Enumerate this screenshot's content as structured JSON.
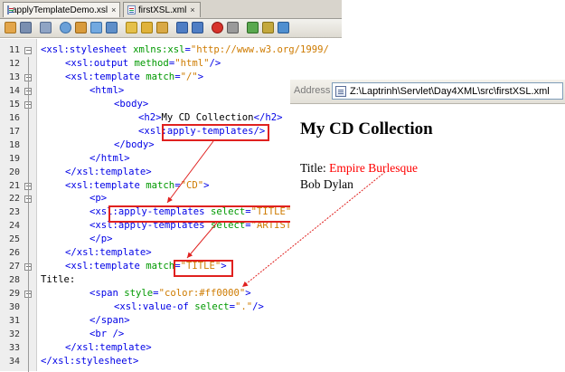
{
  "tabs": [
    {
      "label": "applyTemplateDemo.xsl",
      "close": "×"
    },
    {
      "label": "firstXSL.xml",
      "close": "×"
    }
  ],
  "colors": {
    "tag": "#0000e6",
    "attr": "#009900",
    "value": "#ce7b00",
    "text": "#000000",
    "highlight": "#e0211f",
    "output_title": "#ff0000"
  },
  "code_lines": [
    {
      "n": "11",
      "indent": 0,
      "parts": [
        [
          "t",
          "<xsl:stylesheet "
        ],
        [
          "a",
          "xmlns:xsl"
        ],
        [
          "t",
          "="
        ],
        [
          "v",
          "\"http://www.w3.org/1999/"
        ]
      ]
    },
    {
      "n": "12",
      "indent": 1,
      "parts": [
        [
          "t",
          "<xsl:output "
        ],
        [
          "a",
          "method"
        ],
        [
          "t",
          "="
        ],
        [
          "v",
          "\"html\""
        ],
        [
          "t",
          "/>"
        ]
      ]
    },
    {
      "n": "13",
      "indent": 1,
      "parts": [
        [
          "t",
          "<xsl:template "
        ],
        [
          "a",
          "match"
        ],
        [
          "t",
          "="
        ],
        [
          "v",
          "\"/\""
        ],
        [
          "t",
          ">"
        ]
      ]
    },
    {
      "n": "14",
      "indent": 2,
      "parts": [
        [
          "t",
          "<html>"
        ]
      ]
    },
    {
      "n": "15",
      "indent": 3,
      "parts": [
        [
          "t",
          "<body>"
        ]
      ]
    },
    {
      "n": "16",
      "indent": 4,
      "parts": [
        [
          "t",
          "<h2>"
        ],
        [
          "x",
          "My CD Collection"
        ],
        [
          "t",
          "</h2>"
        ]
      ]
    },
    {
      "n": "17",
      "indent": 4,
      "parts": [
        [
          "t",
          "<xsl:apply-templates/>"
        ]
      ]
    },
    {
      "n": "18",
      "indent": 3,
      "parts": [
        [
          "t",
          "</body>"
        ]
      ]
    },
    {
      "n": "19",
      "indent": 2,
      "parts": [
        [
          "t",
          "</html>"
        ]
      ]
    },
    {
      "n": "20",
      "indent": 1,
      "parts": [
        [
          "t",
          "</xsl:template>"
        ]
      ]
    },
    {
      "n": "21",
      "indent": 1,
      "parts": [
        [
          "t",
          "<xsl:template "
        ],
        [
          "a",
          "match"
        ],
        [
          "t",
          "="
        ],
        [
          "v",
          "\"CD\""
        ],
        [
          "t",
          ">"
        ]
      ]
    },
    {
      "n": "22",
      "indent": 2,
      "parts": [
        [
          "t",
          "<p>"
        ]
      ]
    },
    {
      "n": "23",
      "indent": 2,
      "parts": [
        [
          "t",
          "<xsl:apply-templates "
        ],
        [
          "a",
          "select"
        ],
        [
          "t",
          "="
        ],
        [
          "v",
          "\"TITLE\""
        ],
        [
          "t",
          "/>"
        ]
      ]
    },
    {
      "n": "24",
      "indent": 2,
      "parts": [
        [
          "t",
          "<xsl:apply-templates "
        ],
        [
          "a",
          "select"
        ],
        [
          "t",
          "="
        ],
        [
          "v",
          "\"ARTIST\""
        ],
        [
          "t",
          "/>"
        ]
      ]
    },
    {
      "n": "25",
      "indent": 2,
      "parts": [
        [
          "t",
          "</p>"
        ]
      ]
    },
    {
      "n": "26",
      "indent": 1,
      "parts": [
        [
          "t",
          "</xsl:template>"
        ]
      ]
    },
    {
      "n": "27",
      "indent": 1,
      "parts": [
        [
          "t",
          "<xsl:template "
        ],
        [
          "a",
          "match"
        ],
        [
          "t",
          "="
        ],
        [
          "v",
          "\"TITLE\""
        ],
        [
          "t",
          ">"
        ]
      ]
    },
    {
      "n": "28",
      "indent": 0,
      "parts": [
        [
          "x",
          "Title:"
        ]
      ]
    },
    {
      "n": "29",
      "indent": 2,
      "parts": [
        [
          "t",
          "<span "
        ],
        [
          "a",
          "style"
        ],
        [
          "t",
          "="
        ],
        [
          "v",
          "\"color:#ff0000\""
        ],
        [
          "t",
          ">"
        ]
      ]
    },
    {
      "n": "30",
      "indent": 3,
      "parts": [
        [
          "t",
          "<xsl:value-of "
        ],
        [
          "a",
          "select"
        ],
        [
          "t",
          "="
        ],
        [
          "v",
          "\".\""
        ],
        [
          "t",
          "/>"
        ]
      ]
    },
    {
      "n": "31",
      "indent": 2,
      "parts": [
        [
          "t",
          "</span>"
        ]
      ]
    },
    {
      "n": "32",
      "indent": 2,
      "parts": [
        [
          "t",
          "<br />"
        ]
      ]
    },
    {
      "n": "33",
      "indent": 1,
      "parts": [
        [
          "t",
          "</xsl:template>"
        ]
      ]
    },
    {
      "n": "34",
      "indent": 0,
      "parts": [
        [
          "t",
          "</xsl:stylesheet>"
        ]
      ]
    }
  ],
  "browser": {
    "address_label": "Address",
    "address_value": "Z:\\Laptrinh\\Servlet\\Day4XML\\src\\firstXSL.xml",
    "heading": "My CD Collection",
    "title_label": "Title:",
    "title_value": "Empire Burlesque",
    "artist": "Bob Dylan"
  }
}
